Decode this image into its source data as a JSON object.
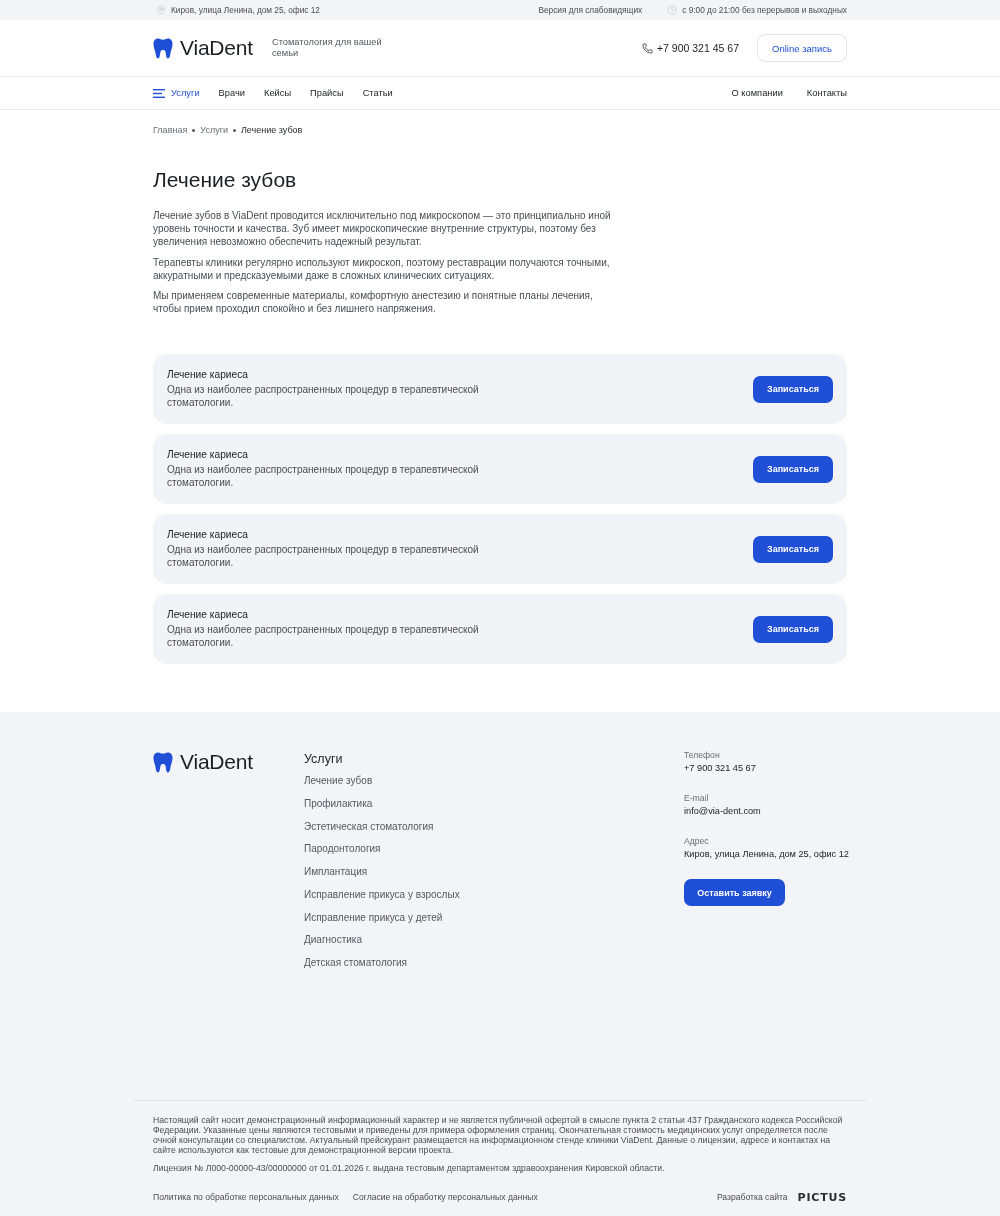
{
  "top_bar": {
    "address": "Киров, улица Ленина, дом 25, офис 12",
    "accessibility_link": "Версия для слабовидящих",
    "hours": "с 9:00 до 21:00 без перерывов и выходных"
  },
  "header": {
    "logo": "ViaDent",
    "tagline": "Стоматология для вашей семьи",
    "phone": "+7 900 321 45 67",
    "booking_button": "Online запись"
  },
  "nav": {
    "left": [
      {
        "label": "Услуги",
        "kind": "menu",
        "selected": true
      },
      {
        "label": "Врачи",
        "kind": "link",
        "selected": false
      },
      {
        "label": "Кейсы",
        "kind": "link",
        "selected": false
      },
      {
        "label": "Прайсы",
        "kind": "link",
        "selected": false
      },
      {
        "label": "Статьи",
        "kind": "link",
        "selected": false
      }
    ],
    "right": [
      {
        "label": "О компании",
        "selected": false
      },
      {
        "label": "Контакты",
        "selected": false
      }
    ]
  },
  "breadcrumbs": [
    {
      "label": "Главная",
      "current": false
    },
    {
      "label": "Услуги",
      "current": false
    },
    {
      "label": "Лечение зубов",
      "current": true
    }
  ],
  "page": {
    "title": "Лечение зубов",
    "paragraphs": [
      "Лечение зубов в ViaDent проводится исключительно под микроскопом — это принципиально иной уровень точности и качества. Зуб имеет микроскопические внутренние структуры, поэтому без увеличения невозможно обеспечить надежный результат.",
      "Терапевты клиники регулярно используют микроскоп, поэтому реставрации получаются точными, аккуратными и предсказуемыми даже в сложных клинических ситуациях.",
      "Мы применяем современные материалы, комфортную анестезию и понятные планы лечения, чтобы прием проходил спокойно и без лишнего напряжения."
    ]
  },
  "services": [
    {
      "title": "Лечение кариеса",
      "description": "Одна из наиболее распространенных процедур в терапевтической стоматологии.",
      "button": "Записаться"
    },
    {
      "title": "Лечение кариеса",
      "description": "Одна из наиболее распространенных процедур в терапевтической стоматологии.",
      "button": "Записаться"
    },
    {
      "title": "Лечение кариеса",
      "description": "Одна из наиболее распространенных процедур в терапевтической стоматологии.",
      "button": "Записаться"
    },
    {
      "title": "Лечение кариеса",
      "description": "Одна из наиболее распространенных процедур в терапевтической стоматологии.",
      "button": "Записаться"
    }
  ],
  "footer": {
    "logo": "ViaDent",
    "services_heading": "Услуги",
    "services": [
      "Лечение зубов",
      "Профилактика",
      "Эстетическая стоматология",
      "Пародонтология",
      "Имплантация",
      "Исправление прикуса у взрослых",
      "Исправление прикуса у детей",
      "Диагностика",
      "Детская стоматология"
    ],
    "contacts": [
      {
        "label": "Телефон",
        "value": "+7 900 321 45 67"
      },
      {
        "label": "E-mail",
        "value": "info@via-dent.com"
      },
      {
        "label": "Адрес",
        "value": "Киров, улица Ленина, дом 25, офис 12"
      }
    ],
    "button": "Оставить заявку",
    "disclaimer": "Настоящий сайт носит демонстрационный информационный характер и не является публичной офертой в смысле пункта 2 статьи 437 Гражданского кодекса Российской Федерации. Указанные цены являются тестовыми и приведены для примера оформления страниц. Окончательная стоимость медицинских услуг определяется после очной консультации со специалистом. Актуальный прейскурант размещается на информационном стенде клиники ViaDent. Данные о лицензии, адресе и контактах на сайте используются как тестовые для демонстрационной версии проекта.",
    "license": "Лицензия № Л000-00000-43/00000000 от 01.01.2026 г. выдана тестовым департаментом здравоохранения Кировской области.",
    "legal_links": [
      "Политика по обработке персональных данных",
      "Согласие на обработку персональных данных"
    ],
    "developer_label": "Разработка сайта",
    "developer_logo": "PICTUS"
  }
}
